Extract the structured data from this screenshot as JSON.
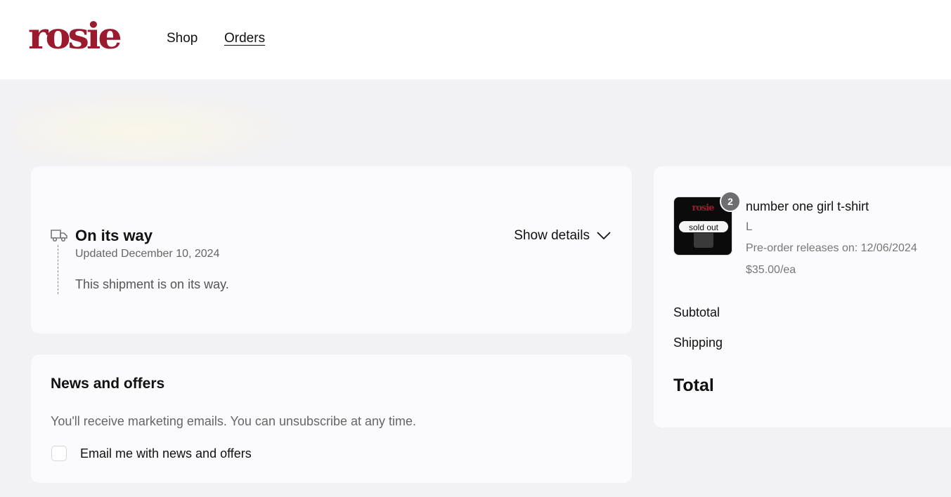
{
  "header": {
    "logo_text": "rosie",
    "nav": {
      "shop": "Shop",
      "orders": "Orders"
    }
  },
  "shipment": {
    "status_title": "On its way",
    "updated": "Updated December 10, 2024",
    "description": "This shipment is on its way.",
    "show_details": "Show details",
    "icon": "truck-icon"
  },
  "news": {
    "title": "News and offers",
    "description": "You'll receive marketing emails. You can unsubscribe at any time.",
    "checkbox_label": "Email me with news and offers",
    "checked": false
  },
  "order_summary": {
    "item": {
      "name": "number one girl t-shirt",
      "variant": "L",
      "preorder": "Pre-order releases on: 12/06/2024",
      "price": "$35.00/ea",
      "quantity": "2",
      "thumb_brand": "rosie",
      "thumb_badge": "sold out"
    },
    "subtotal_label": "Subtotal",
    "shipping_label": "Shipping",
    "total_label": "Total"
  },
  "colors": {
    "brand": "#9b1b2e",
    "background": "#f2f1f3",
    "card": "#fbfafc"
  }
}
